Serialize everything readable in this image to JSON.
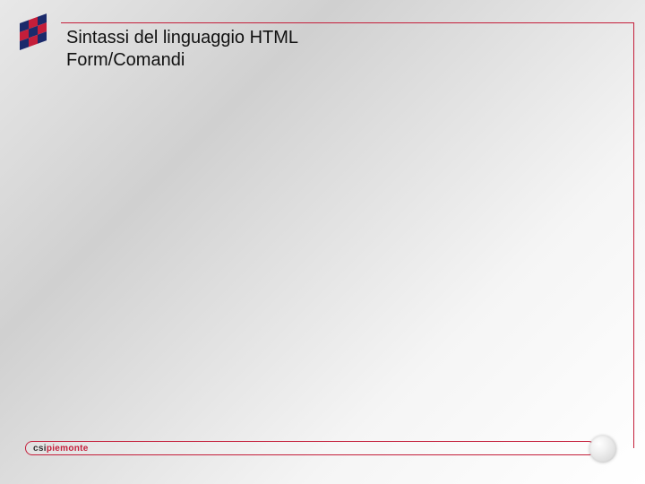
{
  "title_line1": "Sintassi del linguaggio HTML",
  "title_line2": "Form/Comandi",
  "footer": {
    "brand_left": "csi",
    "brand_right": "piemonte"
  },
  "colors": {
    "accent": "#c41e3a",
    "logo_blue": "#1b2a6b"
  }
}
